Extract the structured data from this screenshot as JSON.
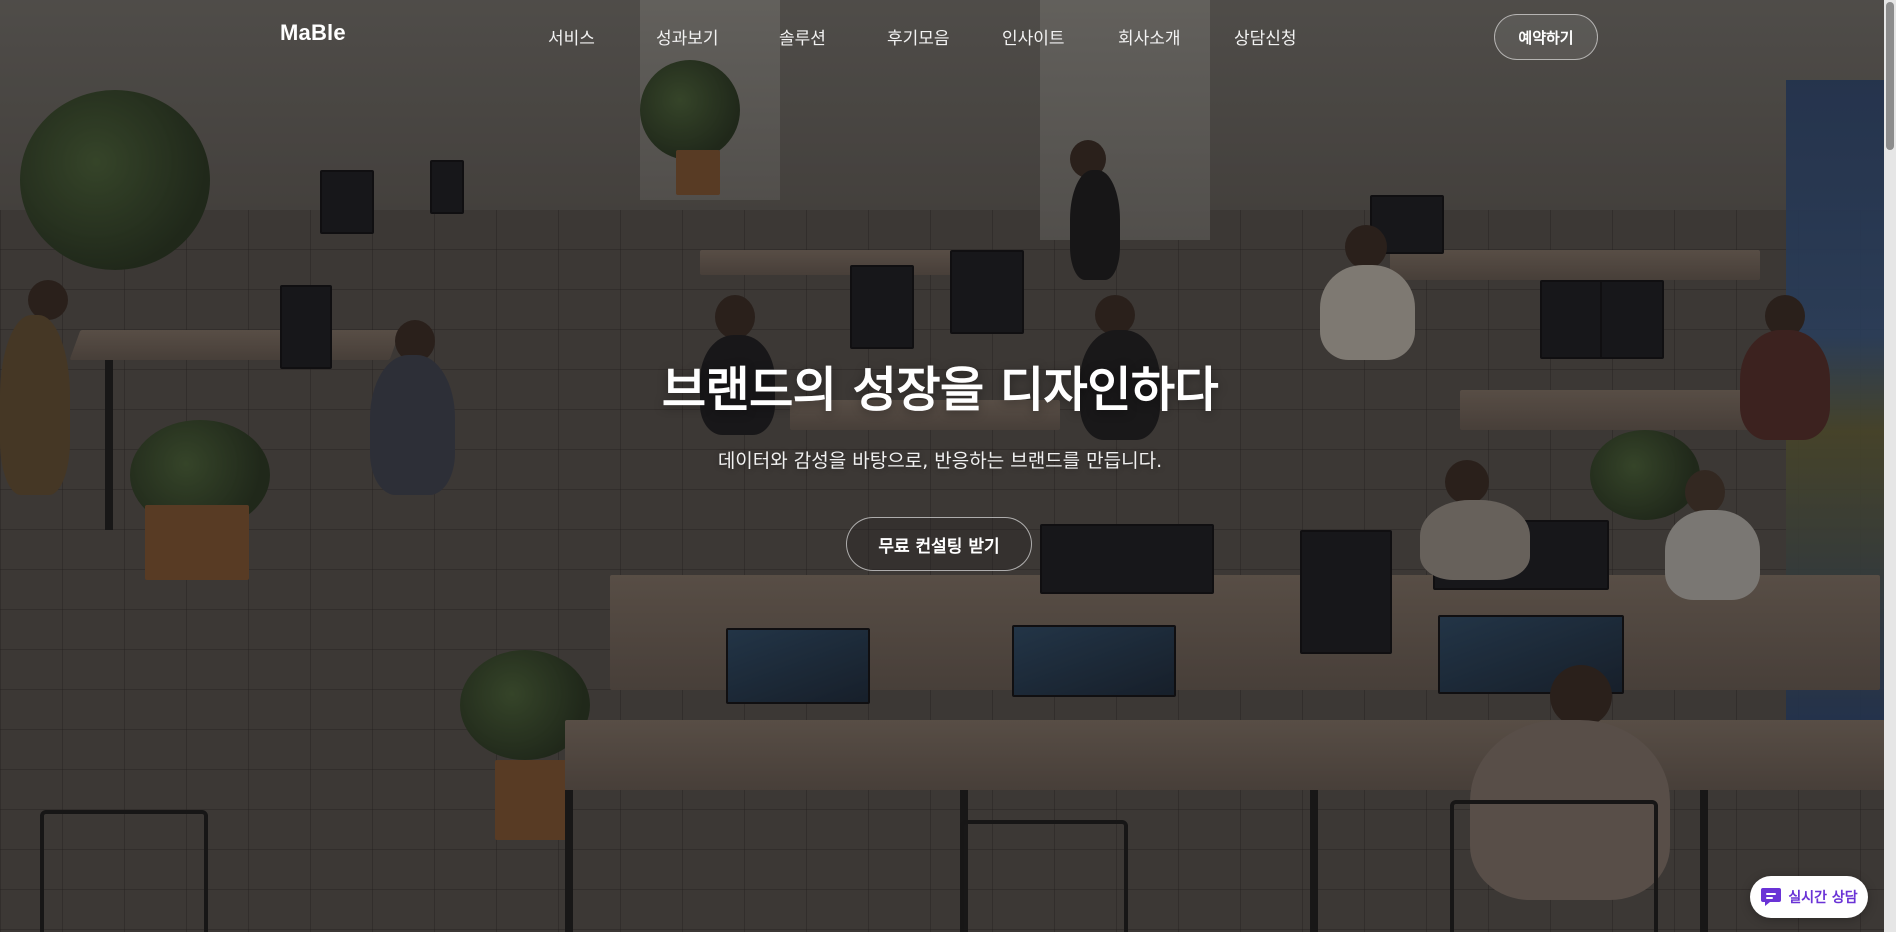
{
  "header": {
    "logo": "MaBle",
    "nav_items": [
      "서비스",
      "성과보기",
      "솔루션",
      "후기모음",
      "인사이트",
      "회사소개",
      "상담신청"
    ],
    "reserve_label": "예약하기"
  },
  "hero": {
    "title": "브랜드의 성장을 디자인하다",
    "subtitle": "데이터와 감성을 바탕으로, 반응하는 브랜드를 만듭니다.",
    "cta_label": "무료 컨설팅 받기"
  },
  "chat": {
    "label": "실시간 상담",
    "icon": "chat-bubble-icon"
  },
  "colors": {
    "chat_accent": "#6a33d6",
    "text": "#ffffff"
  }
}
